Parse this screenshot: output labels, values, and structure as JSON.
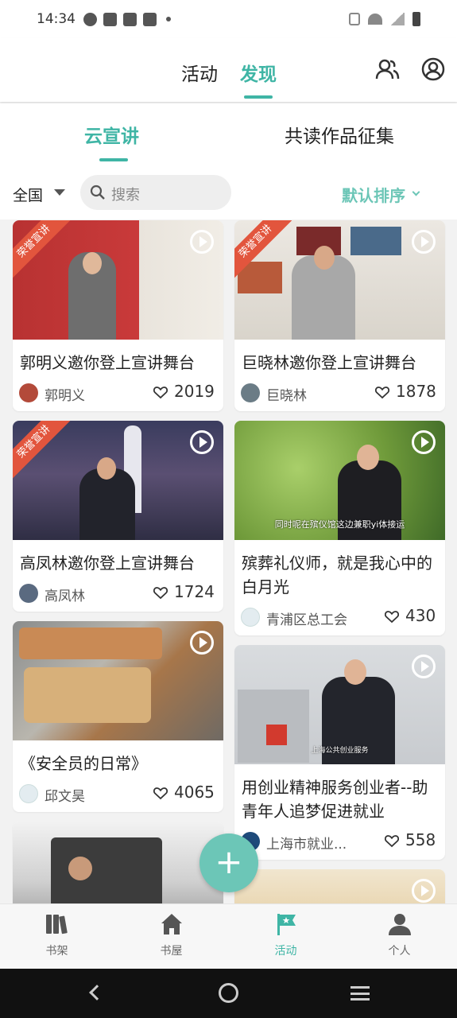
{
  "status_bar": {
    "time": "14:34"
  },
  "header": {
    "tabs": [
      {
        "label": "活动"
      },
      {
        "label": "发现"
      }
    ],
    "active_tab": "发现"
  },
  "sub_tabs": [
    {
      "label": "云宣讲"
    },
    {
      "label": "共读作品征集"
    }
  ],
  "filter": {
    "region": "全国",
    "search_placeholder": "搜索",
    "sort_label": "默认排序"
  },
  "ribbon_label": "荣誉宣讲",
  "cards_left": [
    {
      "title": "郭明义邀你登上宣讲舞台",
      "author": "郭明义",
      "likes": "2019"
    },
    {
      "title": "高凤林邀你登上宣讲舞台",
      "author": "高凤林",
      "likes": "1724"
    },
    {
      "title": "《安全员的日常》",
      "author": "邱文昊",
      "likes": "4065"
    }
  ],
  "cards_right": [
    {
      "title": "巨晓林邀你登上宣讲舞台",
      "author": "巨晓林",
      "likes": "1878"
    },
    {
      "title": "殡葬礼仪师，就是我心中的白月光",
      "author": "青浦区总工会",
      "likes": "430",
      "caption": "同时呢在殡仪馆这边兼职yi体接运"
    },
    {
      "title": "用创业精神服务创业者--助青年人追梦促进就业",
      "author": "上海市就业...",
      "likes": "558",
      "caption": "上海公共创业服务"
    }
  ],
  "bottom_nav": [
    {
      "label": "书架"
    },
    {
      "label": "书屋"
    },
    {
      "label": "活动"
    },
    {
      "label": "个人"
    }
  ],
  "fab_label": "+",
  "colors": {
    "accent": "#3fb5a5",
    "accent_light": "#6cc6b7",
    "ribbon": "#e2553d"
  }
}
